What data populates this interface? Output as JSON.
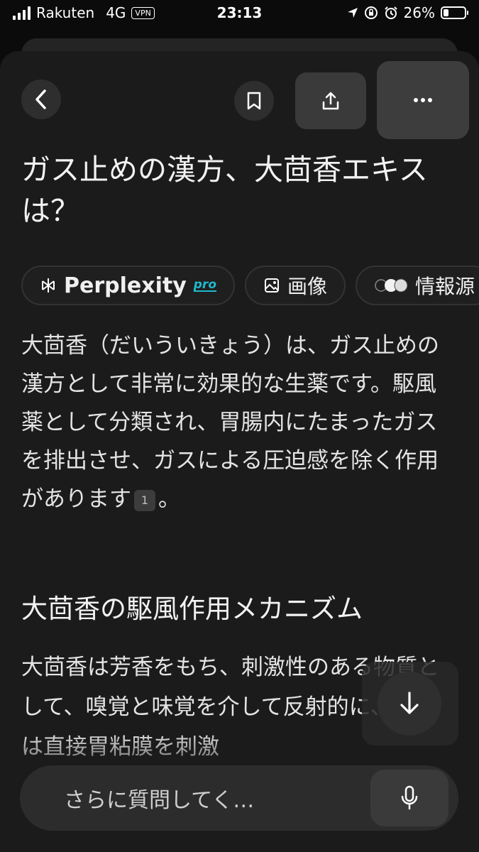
{
  "status_bar": {
    "carrier": "Rakuten",
    "network": "4G",
    "vpn": "VPN",
    "time": "23:13",
    "battery_percent": "26%",
    "battery_level": 0.26
  },
  "header": {
    "back_icon": "chevron-left-icon",
    "bookmark_icon": "bookmark-icon",
    "share_icon": "share-icon",
    "more_icon": "more-horizontal-icon"
  },
  "article": {
    "title": "ガス止めの漢方、大茴香エキスは？",
    "chips": [
      {
        "label": "Perplexity",
        "badge": "pro",
        "icon": "perplexity-logo-icon"
      },
      {
        "label": "画像",
        "icon": "image-icon"
      },
      {
        "label": "情報源",
        "icon": "source-favicons-icon"
      }
    ],
    "paragraph1": "大茴香（だいういきょう）は、ガス止めの漢方として非常に効果的な生薬です。駆風薬として分類され、胃腸内にたまったガスを排出させ、ガスによる圧迫感を除く作用があります",
    "citation": "1",
    "paragraph1_end": "。",
    "heading": "大茴香の駆風作用メカニズム",
    "paragraph2": "大茴香は芳香をもち、刺激性のある物質として、嗅覚と味覚を介して反射的に、または直接胃粘膜を刺激"
  },
  "bottom": {
    "scroll_icon": "arrow-down-icon",
    "ask_placeholder": "さらに質問してく…",
    "mic_icon": "microphone-icon"
  }
}
